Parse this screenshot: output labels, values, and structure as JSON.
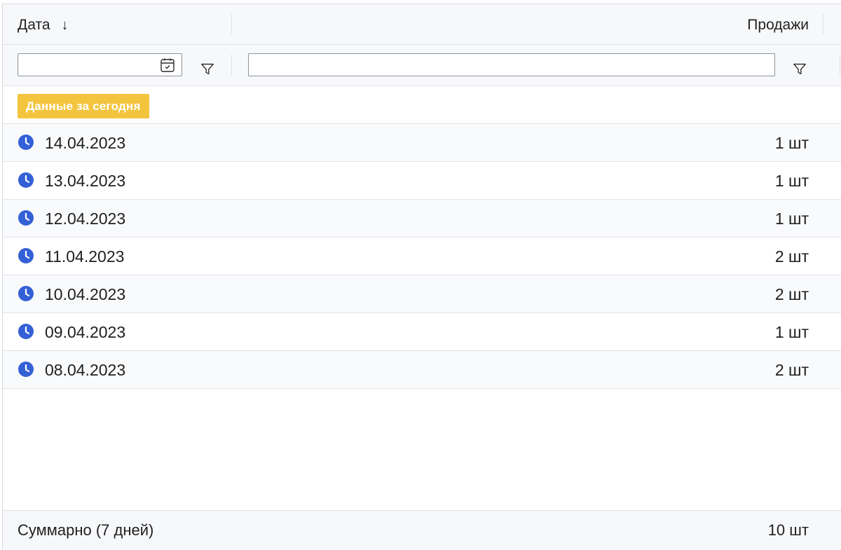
{
  "header": {
    "date_column": "Дата",
    "sort_indicator": "↓",
    "sales_column": "Продажи"
  },
  "filters": {
    "date_value": "",
    "date_placeholder": "",
    "sales_value": "",
    "sales_placeholder": "",
    "icons": [
      "calendar-icon",
      "filter-icon"
    ]
  },
  "group": {
    "label": "Данные за сегодня",
    "badge_color": "#f3c53e"
  },
  "rows": [
    {
      "date": "14.04.2023",
      "sales": "1 шт"
    },
    {
      "date": "13.04.2023",
      "sales": "1 шт"
    },
    {
      "date": "12.04.2023",
      "sales": "1 шт"
    },
    {
      "date": "11.04.2023",
      "sales": "2 шт"
    },
    {
      "date": "10.04.2023",
      "sales": "2 шт"
    },
    {
      "date": "09.04.2023",
      "sales": "1 шт"
    },
    {
      "date": "08.04.2023",
      "sales": "2 шт"
    }
  ],
  "row_icon": "clock-icon",
  "accent_color": "#3460d6",
  "footer": {
    "label": "Суммарно (7 дней)",
    "total": "10 шт"
  }
}
